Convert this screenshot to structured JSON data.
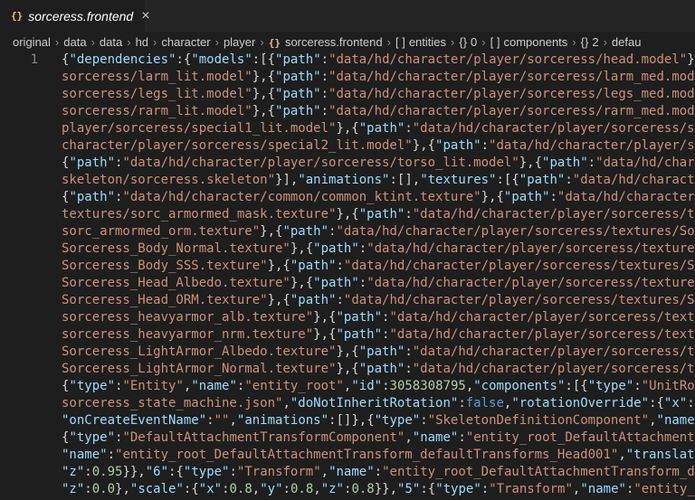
{
  "tab": {
    "icon": "{}",
    "title": "sorceress.frontend",
    "close": "×"
  },
  "breadcrumb": [
    {
      "label": "original"
    },
    {
      "label": "data"
    },
    {
      "label": "data"
    },
    {
      "label": "hd"
    },
    {
      "label": "character"
    },
    {
      "label": "player"
    },
    {
      "icon": "{}",
      "label": "sorceress.frontend"
    },
    {
      "icon": "[ ]",
      "label": "entities"
    },
    {
      "icon": "{}",
      "label": "0"
    },
    {
      "icon": "[ ]",
      "label": "components"
    },
    {
      "icon": "{}",
      "label": "2"
    },
    {
      "icon": "",
      "label": "defau"
    }
  ],
  "editor": {
    "line_number": "1",
    "lines": [
      [
        [
          "p",
          "{"
        ],
        [
          "k",
          "\"dependencies\""
        ],
        [
          "p",
          ":{"
        ],
        [
          "k",
          "\"models\""
        ],
        [
          "p",
          ":[{"
        ],
        [
          "k",
          "\"path\""
        ],
        [
          "p",
          ":"
        ],
        [
          "s",
          "\"data/hd/character/player/sorceress/head.model\""
        ],
        [
          "p",
          "}"
        ]
      ],
      [
        [
          "s",
          "sorceress/larm_lit.model\""
        ],
        [
          "p",
          "},{"
        ],
        [
          "k",
          "\"path\""
        ],
        [
          "p",
          ":"
        ],
        [
          "s",
          "\"data/hd/character/player/sorceress/larm_med.mode"
        ]
      ],
      [
        [
          "s",
          "sorceress/legs_lit.model\""
        ],
        [
          "p",
          "},{"
        ],
        [
          "k",
          "\"path\""
        ],
        [
          "p",
          ":"
        ],
        [
          "s",
          "\"data/hd/character/player/sorceress/legs_med.mode"
        ]
      ],
      [
        [
          "s",
          "sorceress/rarm_lit.model\""
        ],
        [
          "p",
          "},{"
        ],
        [
          "k",
          "\"path\""
        ],
        [
          "p",
          ":"
        ],
        [
          "s",
          "\"data/hd/character/player/sorceress/rarm_med.mode"
        ]
      ],
      [
        [
          "s",
          "player/sorceress/special1_lit.model\""
        ],
        [
          "p",
          "},{"
        ],
        [
          "k",
          "\"path\""
        ],
        [
          "p",
          ":"
        ],
        [
          "s",
          "\"data/hd/character/player/sorceress/sp"
        ]
      ],
      [
        [
          "s",
          "character/player/sorceress/special2_lit.model\""
        ],
        [
          "p",
          "},{"
        ],
        [
          "k",
          "\"path\""
        ],
        [
          "p",
          ":"
        ],
        [
          "s",
          "\"data/hd/character/player/so"
        ]
      ],
      [
        [
          "p",
          "{"
        ],
        [
          "k",
          "\"path\""
        ],
        [
          "p",
          ":"
        ],
        [
          "s",
          "\"data/hd/character/player/sorceress/torso_lit.model\""
        ],
        [
          "p",
          "},{"
        ],
        [
          "k",
          "\"path\""
        ],
        [
          "p",
          ":"
        ],
        [
          "s",
          "\"data/hd/chara"
        ]
      ],
      [
        [
          "s",
          "skeleton/sorceress.skeleton\""
        ],
        [
          "p",
          "}],"
        ],
        [
          "k",
          "\"animations\""
        ],
        [
          "p",
          ":[],"
        ],
        [
          "k",
          "\"textures\""
        ],
        [
          "p",
          ":[{"
        ],
        [
          "k",
          "\"path\""
        ],
        [
          "p",
          ":"
        ],
        [
          "s",
          "\"data/hd/characte"
        ]
      ],
      [
        [
          "p",
          "{"
        ],
        [
          "k",
          "\"path\""
        ],
        [
          "p",
          ":"
        ],
        [
          "s",
          "\"data/hd/character/common/common_ktint.texture\""
        ],
        [
          "p",
          "},{"
        ],
        [
          "k",
          "\"path\""
        ],
        [
          "p",
          ":"
        ],
        [
          "s",
          "\"data/hd/character,"
        ]
      ],
      [
        [
          "s",
          "textures/sorc_armormed_mask.texture\""
        ],
        [
          "p",
          "},{"
        ],
        [
          "k",
          "\"path\""
        ],
        [
          "p",
          ":"
        ],
        [
          "s",
          "\"data/hd/character/player/sorceress/te"
        ]
      ],
      [
        [
          "s",
          "sorc_armormed_orm.texture\""
        ],
        [
          "p",
          "},{"
        ],
        [
          "k",
          "\"path\""
        ],
        [
          "p",
          ":"
        ],
        [
          "s",
          "\"data/hd/character/player/sorceress/textures/So"
        ]
      ],
      [
        [
          "s",
          "Sorceress_Body_Normal.texture\""
        ],
        [
          "p",
          "},{"
        ],
        [
          "k",
          "\"path\""
        ],
        [
          "p",
          ":"
        ],
        [
          "s",
          "\"data/hd/character/player/sorceress/textures"
        ]
      ],
      [
        [
          "s",
          "Sorceress_Body_SSS.texture\""
        ],
        [
          "p",
          "},{"
        ],
        [
          "k",
          "\"path\""
        ],
        [
          "p",
          ":"
        ],
        [
          "s",
          "\"data/hd/character/player/sorceress/textures/Sc"
        ]
      ],
      [
        [
          "s",
          "Sorceress_Head_Albedo.texture\""
        ],
        [
          "p",
          "},{"
        ],
        [
          "k",
          "\"path\""
        ],
        [
          "p",
          ":"
        ],
        [
          "s",
          "\"data/hd/character/player/sorceress/texture"
        ]
      ],
      [
        [
          "s",
          "Sorceress_Head_ORM.texture\""
        ],
        [
          "p",
          "},{"
        ],
        [
          "k",
          "\"path\""
        ],
        [
          "p",
          ":"
        ],
        [
          "s",
          "\"data/hd/character/player/sorceress/textures/Se"
        ]
      ],
      [
        [
          "s",
          "sorceress_heavyarmor_alb.texture\""
        ],
        [
          "p",
          "},{"
        ],
        [
          "k",
          "\"path\""
        ],
        [
          "p",
          ":"
        ],
        [
          "s",
          "\"data/hd/character/player/sorceress/textu"
        ]
      ],
      [
        [
          "s",
          "sorceress_heavyarmor_nrm.texture\""
        ],
        [
          "p",
          "},{"
        ],
        [
          "k",
          "\"path\""
        ],
        [
          "p",
          ":"
        ],
        [
          "s",
          "\"data/hd/character/player/sorceress/textu"
        ]
      ],
      [
        [
          "s",
          "Sorceress_LightArmor_Albedo.texture\""
        ],
        [
          "p",
          "},{"
        ],
        [
          "k",
          "\"path\""
        ],
        [
          "p",
          ":"
        ],
        [
          "s",
          "\"data/hd/character/player/sorceress/te"
        ]
      ],
      [
        [
          "s",
          "Sorceress_LightArmor_Normal.texture\""
        ],
        [
          "p",
          "},{"
        ],
        [
          "k",
          "\"path\""
        ],
        [
          "p",
          ":"
        ],
        [
          "s",
          "\"data/hd/character/player/sorceress/te"
        ]
      ],
      [
        [
          "p",
          "{"
        ],
        [
          "k",
          "\"type\""
        ],
        [
          "p",
          ":"
        ],
        [
          "s",
          "\"Entity\""
        ],
        [
          "p",
          ","
        ],
        [
          "k",
          "\"name\""
        ],
        [
          "p",
          ":"
        ],
        [
          "s",
          "\"entity_root\""
        ],
        [
          "p",
          ","
        ],
        [
          "k",
          "\"id\""
        ],
        [
          "p",
          ":"
        ],
        [
          "n",
          "3058308795"
        ],
        [
          "p",
          ","
        ],
        [
          "k",
          "\"components\""
        ],
        [
          "p",
          ":[{"
        ],
        [
          "k",
          "\"type\""
        ],
        [
          "p",
          ":"
        ],
        [
          "s",
          "\"UnitRo"
        ]
      ],
      [
        [
          "s",
          "sorceress_state_machine.json\""
        ],
        [
          "p",
          ","
        ],
        [
          "k",
          "\"doNotInheritRotation\""
        ],
        [
          "p",
          ":"
        ],
        [
          "b",
          "false"
        ],
        [
          "p",
          ","
        ],
        [
          "k",
          "\"rotationOverride\""
        ],
        [
          "p",
          ":{"
        ],
        [
          "k",
          "\"x\""
        ],
        [
          "p",
          ":("
        ]
      ],
      [
        [
          "k",
          "\"onCreateEventName\""
        ],
        [
          "p",
          ":"
        ],
        [
          "s",
          "\"\""
        ],
        [
          "p",
          ","
        ],
        [
          "k",
          "\"animations\""
        ],
        [
          "p",
          ":[]},{"
        ],
        [
          "k",
          "\"type\""
        ],
        [
          "p",
          ":"
        ],
        [
          "s",
          "\"SkeletonDefinitionComponent\""
        ],
        [
          "p",
          ","
        ],
        [
          "k",
          "\"name\""
        ]
      ],
      [
        [
          "p",
          "{"
        ],
        [
          "k",
          "\"type\""
        ],
        [
          "p",
          ":"
        ],
        [
          "s",
          "\"DefaultAttachmentTransformComponent\""
        ],
        [
          "p",
          ","
        ],
        [
          "k",
          "\"name\""
        ],
        [
          "p",
          ":"
        ],
        [
          "s",
          "\"entity_root_DefaultAttachment"
        ]
      ],
      [
        [
          "k",
          "\"name\""
        ],
        [
          "p",
          ":"
        ],
        [
          "s",
          "\"entity_root_DefaultAttachmentTransform_defaultTransforms_Head001\""
        ],
        [
          "p",
          ","
        ],
        [
          "k",
          "\"translati"
        ]
      ],
      [
        [
          "k",
          "\"z\""
        ],
        [
          "p",
          ":"
        ],
        [
          "n",
          "0.95"
        ],
        [
          "p",
          "}},"
        ],
        [
          "k",
          "\"6\""
        ],
        [
          "p",
          ":{"
        ],
        [
          "k",
          "\"type\""
        ],
        [
          "p",
          ":"
        ],
        [
          "s",
          "\"Transform\""
        ],
        [
          "p",
          ","
        ],
        [
          "k",
          "\"name\""
        ],
        [
          "p",
          ":"
        ],
        [
          "s",
          "\"entity_root_DefaultAttachmentTransform_de"
        ]
      ],
      [
        [
          "k",
          "\"z\""
        ],
        [
          "p",
          ":"
        ],
        [
          "n",
          "0.0"
        ],
        [
          "p",
          "},"
        ],
        [
          "k",
          "\"scale\""
        ],
        [
          "p",
          ":{"
        ],
        [
          "k",
          "\"x\""
        ],
        [
          "p",
          ":"
        ],
        [
          "n",
          "0.8"
        ],
        [
          "p",
          ","
        ],
        [
          "k",
          "\"y\""
        ],
        [
          "p",
          ":"
        ],
        [
          "n",
          "0.8"
        ],
        [
          "p",
          ","
        ],
        [
          "k",
          "\"z\""
        ],
        [
          "p",
          ":"
        ],
        [
          "n",
          "0.8"
        ],
        [
          "p",
          "}},"
        ],
        [
          "k",
          "\"5\""
        ],
        [
          "p",
          ":{"
        ],
        [
          "k",
          "\"type\""
        ],
        [
          "p",
          ":"
        ],
        [
          "s",
          "\"Transform\""
        ],
        [
          "p",
          ","
        ],
        [
          "k",
          "\"name\""
        ],
        [
          "p",
          ":"
        ],
        [
          "s",
          "\"entity_"
        ]
      ]
    ]
  }
}
